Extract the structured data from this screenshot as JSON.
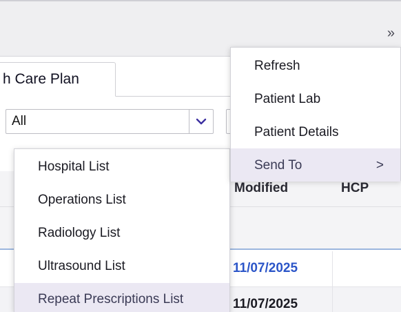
{
  "toolbar": {
    "expand_icon": "double-chevron-right-icon",
    "expand_glyph": "»"
  },
  "tabs": {
    "care_plan_label": "h Care Plan"
  },
  "filter": {
    "select_value": "All",
    "select_arrow_icon": "chevron-down-icon"
  },
  "grid": {
    "columns": [
      "Modified",
      "HCP"
    ],
    "rows": [
      {
        "modified": "11/07/2025",
        "hcp": ""
      },
      {
        "modified": "11/07/2025",
        "hcp": ""
      }
    ]
  },
  "context_menu": {
    "items": [
      {
        "label": "Refresh"
      },
      {
        "label": "Patient Lab"
      },
      {
        "label": "Patient Details"
      },
      {
        "label": "Send To",
        "submenu_arrow": ">"
      }
    ]
  },
  "send_to_submenu": {
    "items": [
      {
        "label": "Hospital List"
      },
      {
        "label": "Operations List"
      },
      {
        "label": "Radiology List"
      },
      {
        "label": "Ultrasound List"
      },
      {
        "label": "Repeat Prescriptions List"
      }
    ]
  },
  "colors": {
    "accent": "#2b55c8",
    "highlight": "#ebe8f3",
    "toolbar_bg": "#efeff1",
    "date_link": "#2b55c8",
    "date_plain": "#1a1a22"
  }
}
